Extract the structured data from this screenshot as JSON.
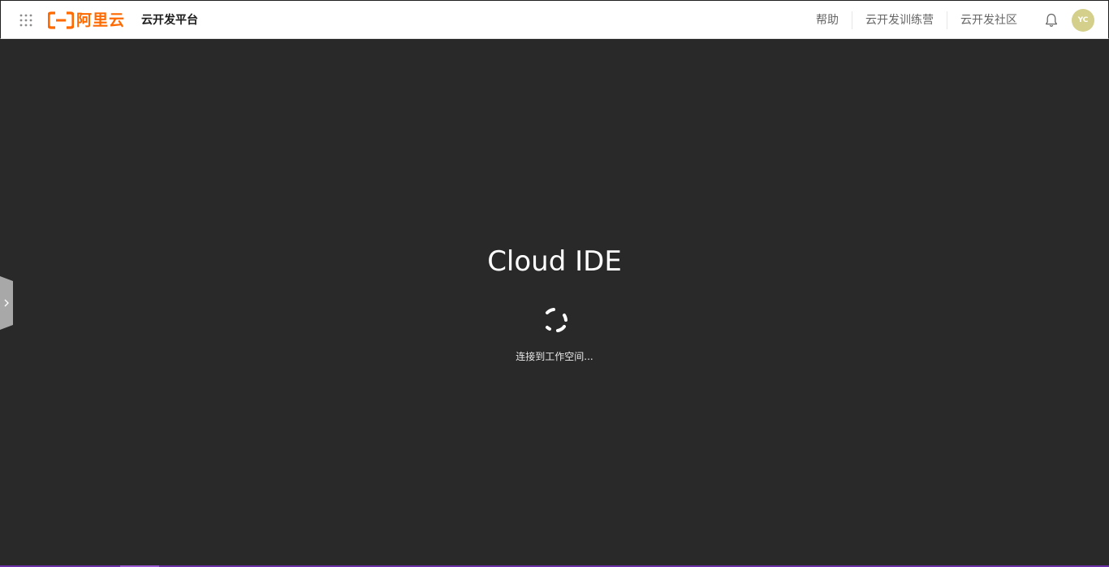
{
  "header": {
    "logo_text": "阿里云",
    "product_name": "云开发平台",
    "nav": {
      "help": "帮助",
      "training": "云开发训练营",
      "community": "云开发社区"
    },
    "avatar_initials": "YC"
  },
  "loader": {
    "title": "Cloud IDE",
    "status": "连接到工作空间..."
  },
  "icons": {
    "grid": "apps-grid-icon",
    "logo": "aliyun-logo-icon",
    "bell": "notification-bell-icon",
    "spinner": "loading-spinner-icon",
    "toggle": "chevron-right-icon"
  },
  "colors": {
    "brand_orange": "#ff6a00",
    "background": "#292929",
    "topbar": "#ffffff",
    "avatar_bg": "#d4cf8a",
    "progress_purple": "#6b2fa8"
  }
}
